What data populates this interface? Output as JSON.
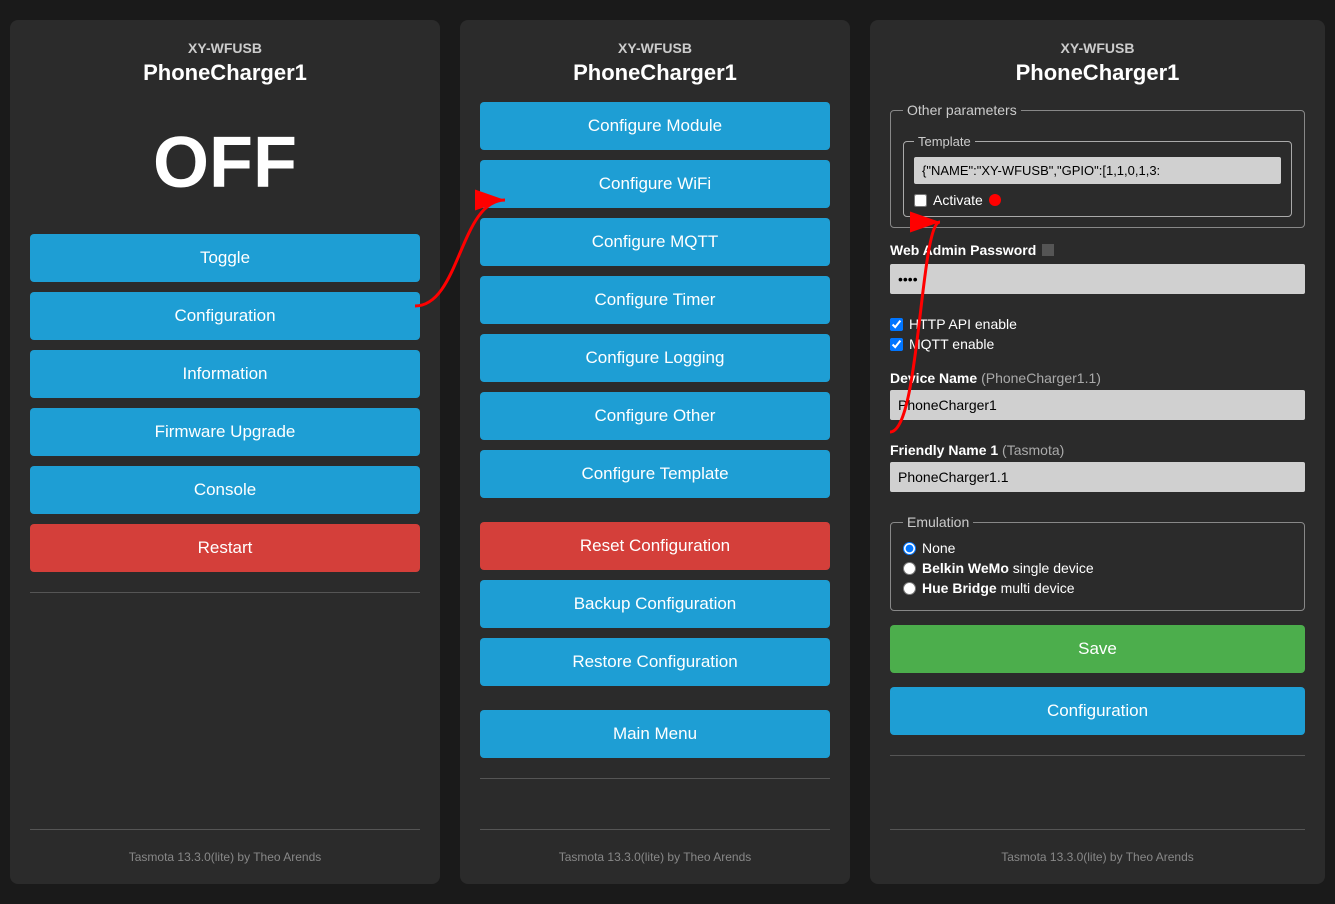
{
  "left": {
    "model": "XY-WFUSB",
    "device": "PhoneCharger1",
    "status": "OFF",
    "buttons": [
      {
        "label": "Toggle",
        "type": "blue",
        "name": "toggle-button"
      },
      {
        "label": "Configuration",
        "type": "blue",
        "name": "configuration-button"
      },
      {
        "label": "Information",
        "type": "blue",
        "name": "information-button"
      },
      {
        "label": "Firmware Upgrade",
        "type": "blue",
        "name": "firmware-upgrade-button"
      },
      {
        "label": "Console",
        "type": "blue",
        "name": "console-button"
      },
      {
        "label": "Restart",
        "type": "red",
        "name": "restart-button"
      }
    ],
    "footer": "Tasmota 13.3.0(lite) by Theo Arends"
  },
  "middle": {
    "model": "XY-WFUSB",
    "device": "PhoneCharger1",
    "buttons": [
      {
        "label": "Configure Module",
        "type": "blue",
        "name": "configure-module-button"
      },
      {
        "label": "Configure WiFi",
        "type": "blue",
        "name": "configure-wifi-button"
      },
      {
        "label": "Configure MQTT",
        "type": "blue",
        "name": "configure-mqtt-button"
      },
      {
        "label": "Configure Timer",
        "type": "blue",
        "name": "configure-timer-button"
      },
      {
        "label": "Configure Logging",
        "type": "blue",
        "name": "configure-logging-button"
      },
      {
        "label": "Configure Other",
        "type": "blue",
        "name": "configure-other-button"
      },
      {
        "label": "Configure Template",
        "type": "blue",
        "name": "configure-template-button"
      },
      {
        "label": "Reset Configuration",
        "type": "red",
        "name": "reset-configuration-button"
      },
      {
        "label": "Backup Configuration",
        "type": "blue",
        "name": "backup-configuration-button"
      },
      {
        "label": "Restore Configuration",
        "type": "blue",
        "name": "restore-configuration-button"
      },
      {
        "label": "Main Menu",
        "type": "blue",
        "name": "main-menu-button"
      }
    ],
    "footer": "Tasmota 13.3.0(lite) by Theo Arends"
  },
  "right": {
    "model": "XY-WFUSB",
    "device": "PhoneCharger1",
    "other_params_label": "Other parameters",
    "template_label": "Template",
    "template_value": "{\"NAME\":\"XY-WFUSB\",\"GPIO\":[1,1,0,1,3:",
    "activate_label": "Activate",
    "web_admin_label": "Web Admin Password",
    "web_admin_value": "••••",
    "http_api_label": "HTTP API enable",
    "mqtt_label": "MQTT enable",
    "device_name_label": "Device Name",
    "device_name_sub": "(PhoneCharger1.1)",
    "device_name_value": "PhoneCharger1",
    "friendly_name_label": "Friendly Name 1",
    "friendly_name_sub": "(Tasmota)",
    "friendly_name_value": "PhoneCharger1.1",
    "emulation_label": "Emulation",
    "emulation_options": [
      {
        "label": "None",
        "selected": true
      },
      {
        "label": "Belkin WeMo single device",
        "selected": false
      },
      {
        "label": "Hue Bridge multi device",
        "selected": false
      }
    ],
    "save_label": "Save",
    "config_label": "Configuration",
    "footer": "Tasmota 13.3.0(lite) by Theo Arends"
  }
}
